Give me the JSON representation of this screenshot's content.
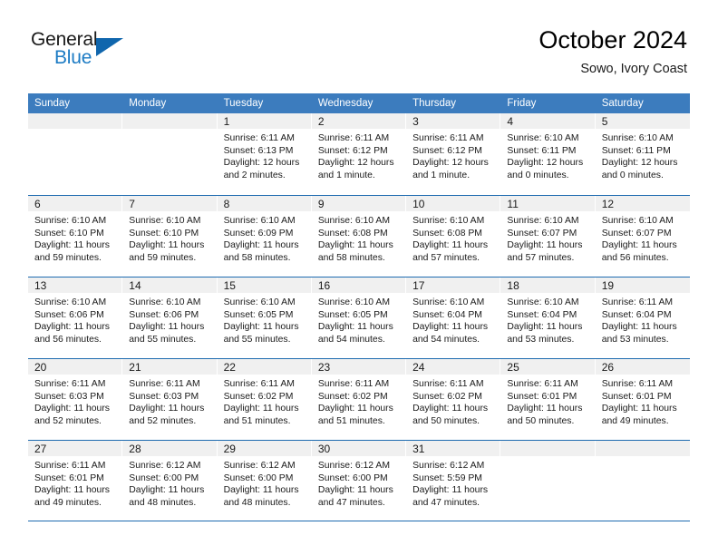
{
  "brand": {
    "name_top": "General",
    "name_bottom": "Blue",
    "triangle_icon": "blue-triangle-icon",
    "accent_color": "#1c7bc4"
  },
  "header": {
    "title": "October 2024",
    "subtitle": "Sowo, Ivory Coast"
  },
  "colors": {
    "header_blue": "#3c7cbe",
    "row_rule": "#1e6bb0",
    "day_strip": "#f0f0f0"
  },
  "weekdays": [
    "Sunday",
    "Monday",
    "Tuesday",
    "Wednesday",
    "Thursday",
    "Friday",
    "Saturday"
  ],
  "weeks": [
    [
      {
        "day": "",
        "lines": []
      },
      {
        "day": "",
        "lines": []
      },
      {
        "day": "1",
        "lines": [
          "Sunrise: 6:11 AM",
          "Sunset: 6:13 PM",
          "Daylight: 12 hours",
          "and 2 minutes."
        ]
      },
      {
        "day": "2",
        "lines": [
          "Sunrise: 6:11 AM",
          "Sunset: 6:12 PM",
          "Daylight: 12 hours",
          "and 1 minute."
        ]
      },
      {
        "day": "3",
        "lines": [
          "Sunrise: 6:11 AM",
          "Sunset: 6:12 PM",
          "Daylight: 12 hours",
          "and 1 minute."
        ]
      },
      {
        "day": "4",
        "lines": [
          "Sunrise: 6:10 AM",
          "Sunset: 6:11 PM",
          "Daylight: 12 hours",
          "and 0 minutes."
        ]
      },
      {
        "day": "5",
        "lines": [
          "Sunrise: 6:10 AM",
          "Sunset: 6:11 PM",
          "Daylight: 12 hours",
          "and 0 minutes."
        ]
      }
    ],
    [
      {
        "day": "6",
        "lines": [
          "Sunrise: 6:10 AM",
          "Sunset: 6:10 PM",
          "Daylight: 11 hours",
          "and 59 minutes."
        ]
      },
      {
        "day": "7",
        "lines": [
          "Sunrise: 6:10 AM",
          "Sunset: 6:10 PM",
          "Daylight: 11 hours",
          "and 59 minutes."
        ]
      },
      {
        "day": "8",
        "lines": [
          "Sunrise: 6:10 AM",
          "Sunset: 6:09 PM",
          "Daylight: 11 hours",
          "and 58 minutes."
        ]
      },
      {
        "day": "9",
        "lines": [
          "Sunrise: 6:10 AM",
          "Sunset: 6:08 PM",
          "Daylight: 11 hours",
          "and 58 minutes."
        ]
      },
      {
        "day": "10",
        "lines": [
          "Sunrise: 6:10 AM",
          "Sunset: 6:08 PM",
          "Daylight: 11 hours",
          "and 57 minutes."
        ]
      },
      {
        "day": "11",
        "lines": [
          "Sunrise: 6:10 AM",
          "Sunset: 6:07 PM",
          "Daylight: 11 hours",
          "and 57 minutes."
        ]
      },
      {
        "day": "12",
        "lines": [
          "Sunrise: 6:10 AM",
          "Sunset: 6:07 PM",
          "Daylight: 11 hours",
          "and 56 minutes."
        ]
      }
    ],
    [
      {
        "day": "13",
        "lines": [
          "Sunrise: 6:10 AM",
          "Sunset: 6:06 PM",
          "Daylight: 11 hours",
          "and 56 minutes."
        ]
      },
      {
        "day": "14",
        "lines": [
          "Sunrise: 6:10 AM",
          "Sunset: 6:06 PM",
          "Daylight: 11 hours",
          "and 55 minutes."
        ]
      },
      {
        "day": "15",
        "lines": [
          "Sunrise: 6:10 AM",
          "Sunset: 6:05 PM",
          "Daylight: 11 hours",
          "and 55 minutes."
        ]
      },
      {
        "day": "16",
        "lines": [
          "Sunrise: 6:10 AM",
          "Sunset: 6:05 PM",
          "Daylight: 11 hours",
          "and 54 minutes."
        ]
      },
      {
        "day": "17",
        "lines": [
          "Sunrise: 6:10 AM",
          "Sunset: 6:04 PM",
          "Daylight: 11 hours",
          "and 54 minutes."
        ]
      },
      {
        "day": "18",
        "lines": [
          "Sunrise: 6:10 AM",
          "Sunset: 6:04 PM",
          "Daylight: 11 hours",
          "and 53 minutes."
        ]
      },
      {
        "day": "19",
        "lines": [
          "Sunrise: 6:11 AM",
          "Sunset: 6:04 PM",
          "Daylight: 11 hours",
          "and 53 minutes."
        ]
      }
    ],
    [
      {
        "day": "20",
        "lines": [
          "Sunrise: 6:11 AM",
          "Sunset: 6:03 PM",
          "Daylight: 11 hours",
          "and 52 minutes."
        ]
      },
      {
        "day": "21",
        "lines": [
          "Sunrise: 6:11 AM",
          "Sunset: 6:03 PM",
          "Daylight: 11 hours",
          "and 52 minutes."
        ]
      },
      {
        "day": "22",
        "lines": [
          "Sunrise: 6:11 AM",
          "Sunset: 6:02 PM",
          "Daylight: 11 hours",
          "and 51 minutes."
        ]
      },
      {
        "day": "23",
        "lines": [
          "Sunrise: 6:11 AM",
          "Sunset: 6:02 PM",
          "Daylight: 11 hours",
          "and 51 minutes."
        ]
      },
      {
        "day": "24",
        "lines": [
          "Sunrise: 6:11 AM",
          "Sunset: 6:02 PM",
          "Daylight: 11 hours",
          "and 50 minutes."
        ]
      },
      {
        "day": "25",
        "lines": [
          "Sunrise: 6:11 AM",
          "Sunset: 6:01 PM",
          "Daylight: 11 hours",
          "and 50 minutes."
        ]
      },
      {
        "day": "26",
        "lines": [
          "Sunrise: 6:11 AM",
          "Sunset: 6:01 PM",
          "Daylight: 11 hours",
          "and 49 minutes."
        ]
      }
    ],
    [
      {
        "day": "27",
        "lines": [
          "Sunrise: 6:11 AM",
          "Sunset: 6:01 PM",
          "Daylight: 11 hours",
          "and 49 minutes."
        ]
      },
      {
        "day": "28",
        "lines": [
          "Sunrise: 6:12 AM",
          "Sunset: 6:00 PM",
          "Daylight: 11 hours",
          "and 48 minutes."
        ]
      },
      {
        "day": "29",
        "lines": [
          "Sunrise: 6:12 AM",
          "Sunset: 6:00 PM",
          "Daylight: 11 hours",
          "and 48 minutes."
        ]
      },
      {
        "day": "30",
        "lines": [
          "Sunrise: 6:12 AM",
          "Sunset: 6:00 PM",
          "Daylight: 11 hours",
          "and 47 minutes."
        ]
      },
      {
        "day": "31",
        "lines": [
          "Sunrise: 6:12 AM",
          "Sunset: 5:59 PM",
          "Daylight: 11 hours",
          "and 47 minutes."
        ]
      },
      {
        "day": "",
        "lines": []
      },
      {
        "day": "",
        "lines": []
      }
    ]
  ]
}
